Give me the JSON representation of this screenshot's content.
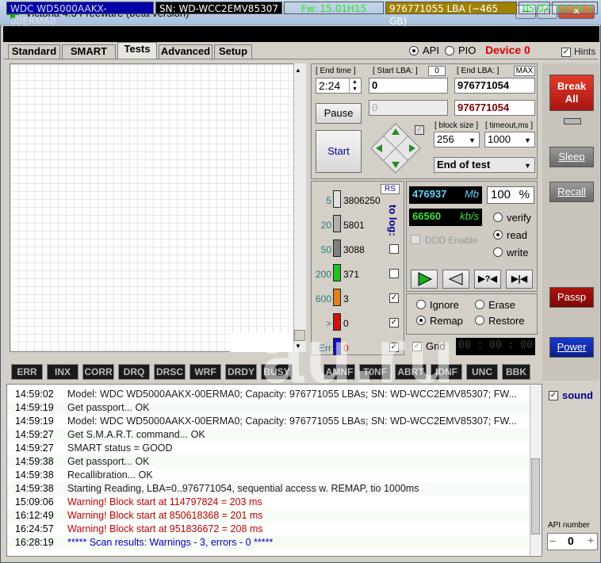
{
  "window": {
    "title": "Victoria 4.3 Freeware (beta version)"
  },
  "drive": {
    "model": "WDC WD5000AAKX-00ERMA0",
    "serial": "SN: WD-WCC2EMV85307",
    "firmware": "Fw: 15.01H15",
    "capacity": "976771055 LBA (~465 GB)",
    "date": "05.07",
    "time": "16:28:3"
  },
  "tabs": [
    "Standard",
    "SMART",
    "Tests",
    "Advanced",
    "Setup"
  ],
  "mode": {
    "api": "API",
    "pio": "PIO",
    "device": "Device 0",
    "hints": "Hints"
  },
  "controls": {
    "end_time_label": "[ End time ]",
    "end_time": "2:24",
    "start_lba_label": "[ Start LBA: ]",
    "start_lba_zero": "0",
    "start_lba": "0",
    "start_lba2": "0",
    "end_lba_label": "[ End LBA: ]",
    "max": "MAX",
    "end_lba": "976771054",
    "end_lba2": "976771054",
    "pause": "Pause",
    "start": "Start",
    "block_size_label": "[ block size ]",
    "block_size": "256",
    "timeout_label": "[ timeout,ms ]",
    "timeout": "1000",
    "end_action": "End of test"
  },
  "stats": {
    "rs": "RS",
    "to_log": "to log:",
    "rows": [
      {
        "ms": "5",
        "count": "3806250",
        "color": "#e0e0e0"
      },
      {
        "ms": "20",
        "count": "5801",
        "color": "#b0b0b0"
      },
      {
        "ms": "50",
        "count": "3088",
        "color": "#808080"
      },
      {
        "ms": "200",
        "count": "371",
        "color": "#22c022"
      },
      {
        "ms": "600",
        "count": "3",
        "color": "#e08020"
      },
      {
        "ms": ">",
        "count": "0",
        "color": "#d01010"
      },
      {
        "ms": "Err",
        "count": "0",
        "color": "#1010c0"
      }
    ]
  },
  "progress": {
    "mb": "476937",
    "mb_unit": "Mb",
    "percent": "100",
    "pct_sign": "%",
    "speed": "66560",
    "speed_unit": "kb/s",
    "ddd": "DDD Enable",
    "verify": "verify",
    "read": "read",
    "write": "write"
  },
  "action": {
    "ignore": "Ignore",
    "erase": "Erase",
    "remap": "Remap",
    "restore": "Restore",
    "grid": "Grid",
    "timer": "00 : 00 : 00"
  },
  "side": {
    "break_all": "Break All",
    "sleep": "Sleep",
    "recall": "Recall",
    "passp": "Passp",
    "power": "Power",
    "sound": "sound",
    "api_number_label": "API number",
    "api_number": "0",
    "minus": "−",
    "plus": "+"
  },
  "flags": [
    "ERR",
    "INX",
    "CORR",
    "DRQ",
    "DRSC",
    "WRF",
    "DRDY",
    "BUSY",
    "AMNF",
    "T0NF",
    "ABRT",
    "IDNF",
    "UNC",
    "BBK"
  ],
  "watermark": "au.ru",
  "log": [
    {
      "time": "14:59:02",
      "msg": "Model: WDC WD5000AAKX-00ERMA0; Capacity: 976771055 LBAs; SN: WD-WCC2EMV85307; FW...",
      "kind": "n"
    },
    {
      "time": "14:59:19",
      "msg": "Get passport... OK",
      "kind": "n"
    },
    {
      "time": "14:59:19",
      "msg": "Model: WDC WD5000AAKX-00ERMA0; Capacity: 976771055 LBAs; SN: WD-WCC2EMV85307; FW...",
      "kind": "n"
    },
    {
      "time": "14:59:27",
      "msg": "Get S.M.A.R.T. command... OK",
      "kind": "n"
    },
    {
      "time": "14:59:27",
      "msg": "SMART status = GOOD",
      "kind": "n"
    },
    {
      "time": "14:59:38",
      "msg": "Get passport... OK",
      "kind": "n"
    },
    {
      "time": "14:59:38",
      "msg": "Recallibration... OK",
      "kind": "n"
    },
    {
      "time": "14:59:38",
      "msg": "Starting Reading, LBA=0..976771054, sequential access w. REMAP, tio 1000ms",
      "kind": "n"
    },
    {
      "time": "15:09:06",
      "msg": "Warning! Block start at 114797824 = 203 ms",
      "kind": "w"
    },
    {
      "time": "16:12:49",
      "msg": "Warning! Block start at 850618368 = 201 ms",
      "kind": "w"
    },
    {
      "time": "16:24:57",
      "msg": "Warning! Block start at 951836672 = 208 ms",
      "kind": "w"
    },
    {
      "time": "16:28:19",
      "msg": "***** Scan results: Warnings - 3, errors - 0 *****",
      "kind": "r"
    }
  ]
}
